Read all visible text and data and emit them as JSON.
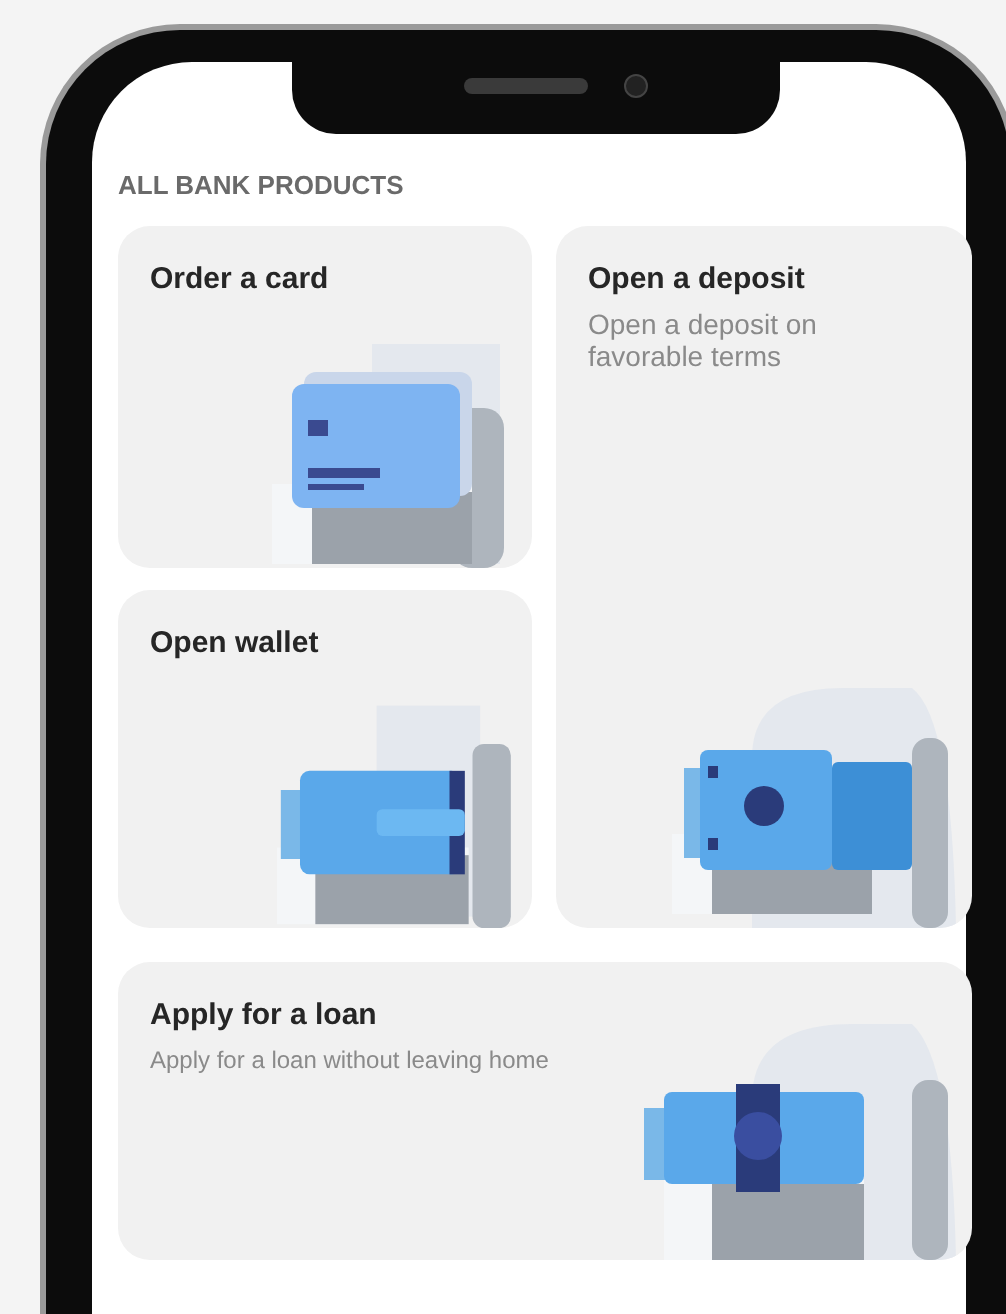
{
  "section_title": "ALL BANK PRODUCTS",
  "products": [
    {
      "kind": "card",
      "title": "Order a card"
    },
    {
      "kind": "deposit",
      "title": "Open a deposit",
      "subtitle": "Open a deposit on favorable terms"
    },
    {
      "kind": "wallet",
      "title": "Open wallet"
    },
    {
      "kind": "loan",
      "title": "Apply for a loan",
      "subtitle": "Apply for a loan without leaving home"
    }
  ]
}
